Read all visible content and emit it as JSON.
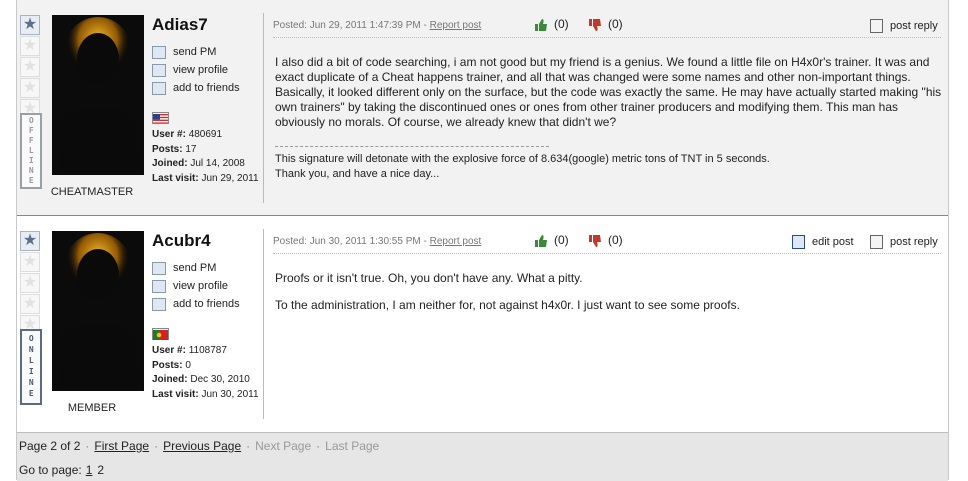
{
  "colors": {
    "post1_bg": "#f2f2f2",
    "post2_bg": "#ffffff",
    "footer_bg": "#e6e6e6",
    "star_active": "#5d6f8e",
    "thumb_up": "#3a8a3a",
    "thumb_down": "#c0392b"
  },
  "posts": [
    {
      "username": "Adias7",
      "links": [
        "send PM",
        "view profile",
        "add to friends"
      ],
      "flag": "us-flag",
      "stats": {
        "user_label": "User #:",
        "user": "480691",
        "posts_label": "Posts:",
        "posts": "17",
        "joined_label": "Joined:",
        "joined": "Jul 14, 2008",
        "visit_label": "Last visit:",
        "visit": "Jun 29, 2011"
      },
      "rank_stars": 1,
      "status": "OFFLINE",
      "role": "CHEATMASTER",
      "posted_label": "Posted:",
      "posted": "Jun 29, 2011 1:47:39 PM",
      "dash": " - ",
      "report": "Report post",
      "likes": "(0)",
      "dislikes": "(0)",
      "actions": [
        "post reply"
      ],
      "body": [
        "I also did a bit of code searching, i am not good but my friend is a genius. We found a little file on H4x0r's trainer. It was and exact duplicate of a Cheat happens trainer, and all that was changed were some names and other non-important things. Basically, it looked different only on the surface, but the code was exactly the same. He may have actually started making \"his own trainers\" by taking the discontinued ones or ones from other trainer producers and modifying them. This man has obviously no morals. Of course, we already knew that didn't we?"
      ],
      "signature": [
        "This signature will detonate with the explosive force of 8.634(google) metric tons of TNT in 5 seconds.",
        "Thank you, and have a nice day..."
      ]
    },
    {
      "username": "Acubr4",
      "links": [
        "send PM",
        "view profile",
        "add to friends"
      ],
      "flag": "portugal-flag",
      "stats": {
        "user_label": "User #:",
        "user": "1108787",
        "posts_label": "Posts:",
        "posts": "0",
        "joined_label": "Joined:",
        "joined": "Dec 30, 2010",
        "visit_label": "Last visit:",
        "visit": "Jun 30, 2011"
      },
      "rank_stars": 1,
      "status": "ONLINE",
      "role": "MEMBER",
      "posted_label": "Posted:",
      "posted": "Jun 30, 2011 1:30:55 PM",
      "dash": " - ",
      "report": "Report post",
      "likes": "(0)",
      "dislikes": "(0)",
      "actions": [
        "edit post",
        "post reply"
      ],
      "body": [
        "Proofs or it isn't true. Oh, you don't have any. What a pitty.",
        "To the administration, I am neither for, not against h4x0r. I just want to see some proofs."
      ]
    }
  ],
  "pager": {
    "page_of": "Page 2 of 2",
    "dot": "·",
    "first": "First Page",
    "previous": "Previous Page",
    "next": "Next Page",
    "last": "Last Page",
    "goto_label": "Go to page:",
    "pages": [
      "1",
      "2"
    ]
  }
}
